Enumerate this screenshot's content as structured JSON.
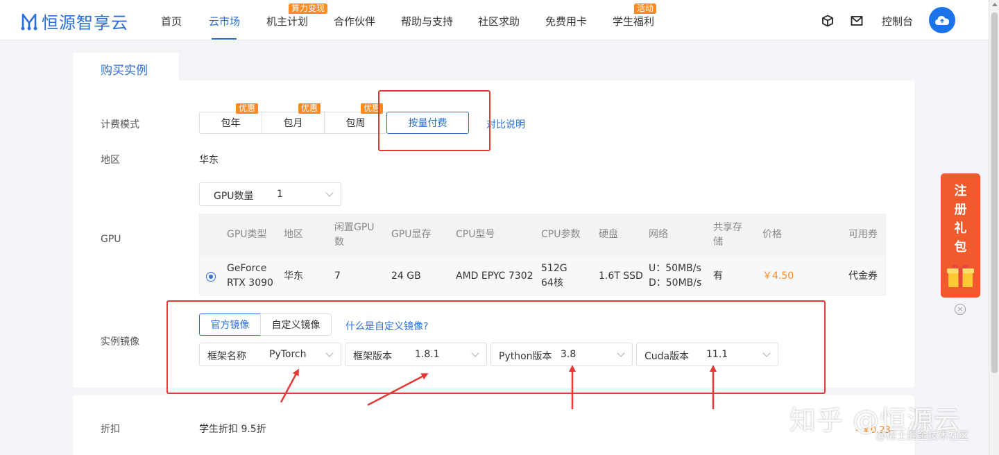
{
  "nav": {
    "logo_text": "恒源智享云",
    "items": [
      {
        "label": "首页"
      },
      {
        "label": "云市场"
      },
      {
        "label": "机主计划",
        "badge": "算力变现"
      },
      {
        "label": "合作伙伴"
      },
      {
        "label": "帮助与支持"
      },
      {
        "label": "社区求助"
      },
      {
        "label": "免费用卡"
      },
      {
        "label": "学生福利",
        "badge": "活动"
      }
    ],
    "console_label": "控制台"
  },
  "tab_label": "购买实例",
  "billing": {
    "label": "计费模式",
    "options": [
      {
        "label": "包年",
        "promo": "优惠"
      },
      {
        "label": "包月",
        "promo": "优惠"
      },
      {
        "label": "包周",
        "promo": "优惠"
      },
      {
        "label": "按量付费",
        "selected": true
      }
    ],
    "compare_link": "对比说明"
  },
  "region": {
    "label": "地区",
    "value": "华东"
  },
  "gpu": {
    "label": "GPU",
    "count_select": {
      "label": "GPU数量",
      "value": "1"
    },
    "headers": {
      "type": "GPU类型",
      "region": "地区",
      "idle": "闲置GPU数",
      "mem": "GPU显存",
      "cpu_model": "CPU型号",
      "cpu_params": "CPU参数",
      "disk": "硬盘",
      "network": "网络",
      "storage": "共享存储",
      "price": "价格",
      "coupon": "可用券"
    },
    "row": {
      "type": "GeForce RTX 3090",
      "region": "华东",
      "idle": "7",
      "mem": "24 GB",
      "cpu_model": "AMD EPYC 7302",
      "cpu_params_1": "512G",
      "cpu_params_2": "64核",
      "disk": "1.6T SSD",
      "network_up": "U：50MB/s",
      "network_down": "D：50MB/s",
      "storage": "有",
      "price": "￥4.50",
      "coupon": "代金券"
    }
  },
  "image": {
    "label": "实例镜像",
    "tabs": [
      {
        "label": "官方镜像",
        "selected": true
      },
      {
        "label": "自定义镜像"
      }
    ],
    "help_link": "什么是自定义镜像?",
    "selects": [
      {
        "label": "框架名称",
        "value": "PyTorch"
      },
      {
        "label": "框架版本",
        "value": "1.8.1"
      },
      {
        "label": "Python版本",
        "value": "3.8"
      },
      {
        "label": "Cuda版本",
        "value": "11.1"
      }
    ]
  },
  "discount": {
    "label": "折扣",
    "value": "学生折扣 9.5折",
    "price_partial": "- ￥0.23"
  },
  "gift": {
    "chars": [
      "注",
      "册",
      "礼",
      "包"
    ]
  },
  "watermarks": {
    "zhihu": "知乎 @恒源云",
    "juejin": "@稀土掘金技术社区"
  },
  "colors": {
    "brand": "#2a6fd6",
    "accent": "#ff8a1f",
    "annotation": "#e53935",
    "gift_bg": "#f15a2c"
  }
}
